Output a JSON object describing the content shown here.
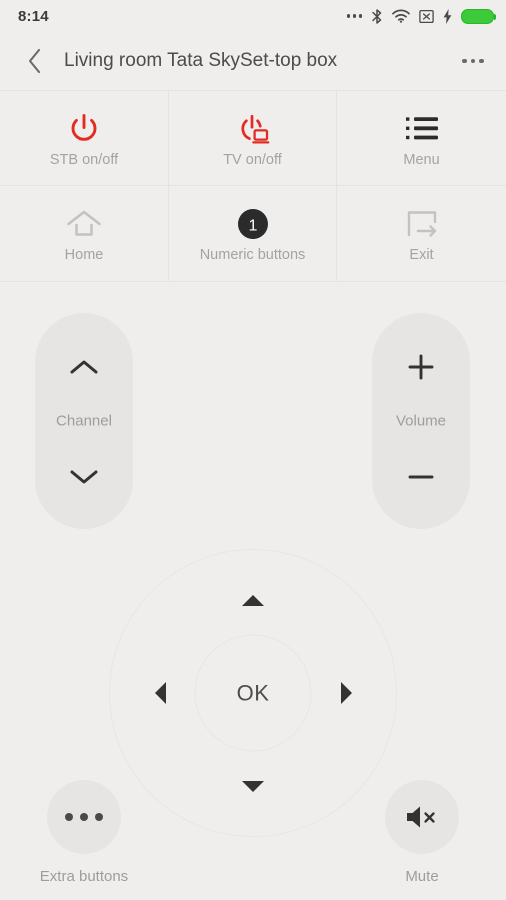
{
  "status_bar": {
    "time": "8:14",
    "icons": [
      {
        "name": "more-indicators-icon",
        "glyph": "dots"
      },
      {
        "name": "bluetooth-icon",
        "glyph": "bluetooth"
      },
      {
        "name": "wifi-icon",
        "glyph": "wifi"
      },
      {
        "name": "no-sim-icon",
        "glyph": "no-sim"
      },
      {
        "name": "charging-bolt-icon",
        "glyph": "bolt"
      },
      {
        "name": "battery-icon",
        "glyph": "battery"
      }
    ],
    "battery_color": "#3cc93a"
  },
  "title_bar": {
    "back_label": "Back",
    "title": "Living room Tata SkySet-top box",
    "overflow_label": "More options"
  },
  "grid": {
    "buttons": [
      {
        "label": "STB on/off",
        "icon": "power-icon",
        "color": "#e42b22"
      },
      {
        "label": "TV on/off",
        "icon": "tv-power-icon",
        "color": "#e42b22"
      },
      {
        "label": "Menu",
        "icon": "menu-list-icon",
        "color": "#2b2b2b"
      },
      {
        "label": "Home",
        "icon": "home-icon",
        "color": "#c2c2c2"
      },
      {
        "label": "Numeric buttons",
        "icon": "numeric-one-icon",
        "color": "#2b2b2b"
      },
      {
        "label": "Exit",
        "icon": "exit-arrow-icon",
        "color": "#c2c2c2"
      }
    ]
  },
  "channel_pill": {
    "label": "Channel",
    "up_icon": "chevron-up-icon",
    "down_icon": "chevron-down-icon"
  },
  "volume_pill": {
    "label": "Volume",
    "up_icon": "plus-icon",
    "down_icon": "minus-icon"
  },
  "dpad": {
    "ok_label": "OK",
    "up_icon": "triangle-up-icon",
    "down_icon": "triangle-down-icon",
    "left_icon": "triangle-left-icon",
    "right_icon": "triangle-right-icon"
  },
  "extra_buttons": {
    "label": "Extra buttons",
    "icon": "ellipsis-icon"
  },
  "mute_button": {
    "label": "Mute",
    "icon": "volume-mute-icon"
  },
  "theme": {
    "background": "#efeeed",
    "surface": "#e6e5e4",
    "accent_red": "#e42b22",
    "label_gray": "#a3a3a3"
  }
}
